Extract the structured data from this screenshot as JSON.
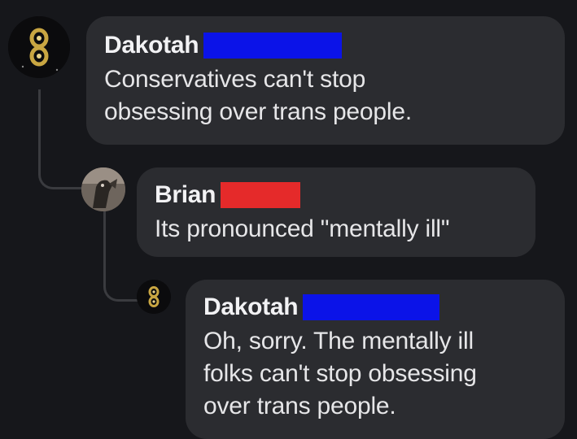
{
  "comments": [
    {
      "author": "Dakotah",
      "text_lines": [
        "Conservatives can't stop",
        "obsessing over trans people."
      ],
      "redaction_color": "#0b13e8"
    },
    {
      "author": "Brian",
      "text_lines": [
        "Its pronounced \"mentally ill\""
      ],
      "redaction_color": "#e52a2a"
    },
    {
      "author": "Dakotah",
      "text_lines": [
        "Oh, sorry. The mentally ill",
        "folks can't stop obsessing",
        "over trans people."
      ],
      "redaction_color": "#0b13e8"
    }
  ],
  "colors": {
    "background": "#16171b",
    "bubble": "#2b2c30",
    "thread_line": "#3a3b3f"
  }
}
